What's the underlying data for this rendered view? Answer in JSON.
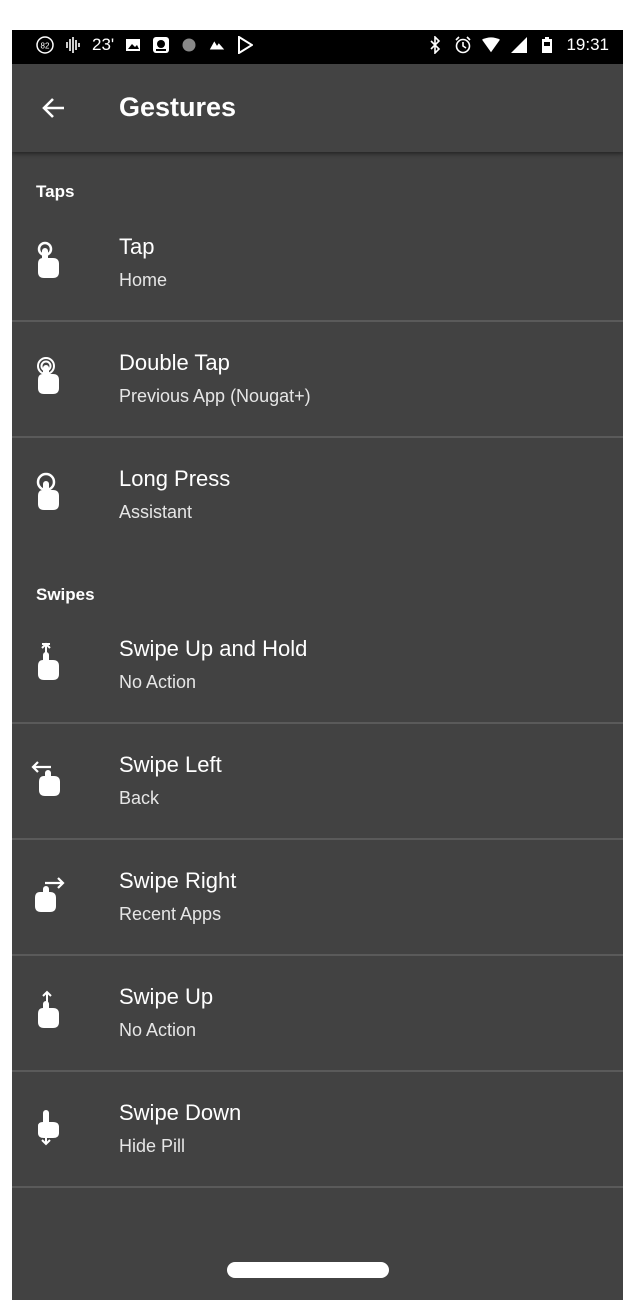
{
  "status_bar": {
    "notification_count": "82",
    "temperature": "23'",
    "time": "19:31",
    "left_icons": [
      "notification-count-icon",
      "audio-wave-icon",
      "image-icon",
      "app-icon",
      "circle-icon",
      "cloud-icon",
      "play-store-icon"
    ],
    "right_icons": [
      "bluetooth-icon",
      "alarm-icon",
      "wifi-icon",
      "signal-icon",
      "battery-icon"
    ]
  },
  "app_bar": {
    "title": "Gestures"
  },
  "sections": [
    {
      "header": "Taps",
      "items": [
        {
          "title": "Tap",
          "subtitle": "Home",
          "icon": "tap-gesture-icon"
        },
        {
          "title": "Double Tap",
          "subtitle": "Previous App (Nougat+)",
          "icon": "double-tap-gesture-icon"
        },
        {
          "title": "Long Press",
          "subtitle": "Assistant",
          "icon": "long-press-gesture-icon"
        }
      ]
    },
    {
      "header": "Swipes",
      "items": [
        {
          "title": "Swipe Up and Hold",
          "subtitle": "No Action",
          "icon": "swipe-up-hold-gesture-icon"
        },
        {
          "title": "Swipe Left",
          "subtitle": "Back",
          "icon": "swipe-left-gesture-icon"
        },
        {
          "title": "Swipe Right",
          "subtitle": "Recent Apps",
          "icon": "swipe-right-gesture-icon"
        },
        {
          "title": "Swipe Up",
          "subtitle": "No Action",
          "icon": "swipe-up-gesture-icon"
        },
        {
          "title": "Swipe Down",
          "subtitle": "Hide Pill",
          "icon": "swipe-down-gesture-icon"
        }
      ]
    }
  ],
  "colors": {
    "background": "#424242",
    "status_bar": "#000000",
    "text": "#ffffff",
    "divider": "#5a5a5a"
  }
}
